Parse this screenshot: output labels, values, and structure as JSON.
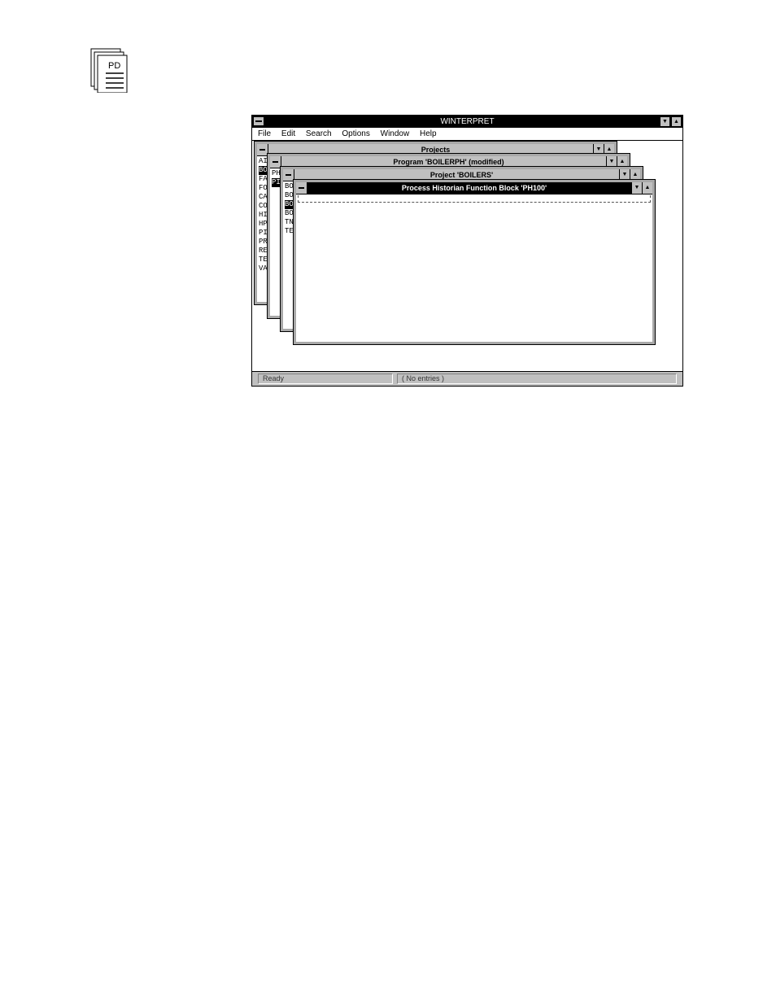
{
  "doc_icon": {
    "label": "PD"
  },
  "app": {
    "title": "WINTERPRET",
    "menus": [
      "File",
      "Edit",
      "Search",
      "Options",
      "Window",
      "Help"
    ],
    "status": {
      "left": "Ready",
      "right": "( No entries )"
    }
  },
  "windows": {
    "projects": {
      "title": "Projects",
      "items": [
        "AI",
        "BO",
        "FA",
        "FO",
        "CA",
        "CO",
        "HI",
        "HP",
        "PI",
        "PR",
        "RE",
        "TE",
        "VA"
      ]
    },
    "program": {
      "title": "Program 'BOILERPH' (modified)",
      "items": [
        "PH",
        "PI"
      ]
    },
    "project": {
      "title": "Project 'BOILERS'",
      "items": [
        "BO",
        "BO",
        "BO",
        "BO",
        "TN",
        "TE"
      ]
    },
    "block": {
      "title": "Process Historian Function Block 'PH100'"
    }
  },
  "glyphs": {
    "minimize": "▼",
    "maximize": "▲"
  }
}
